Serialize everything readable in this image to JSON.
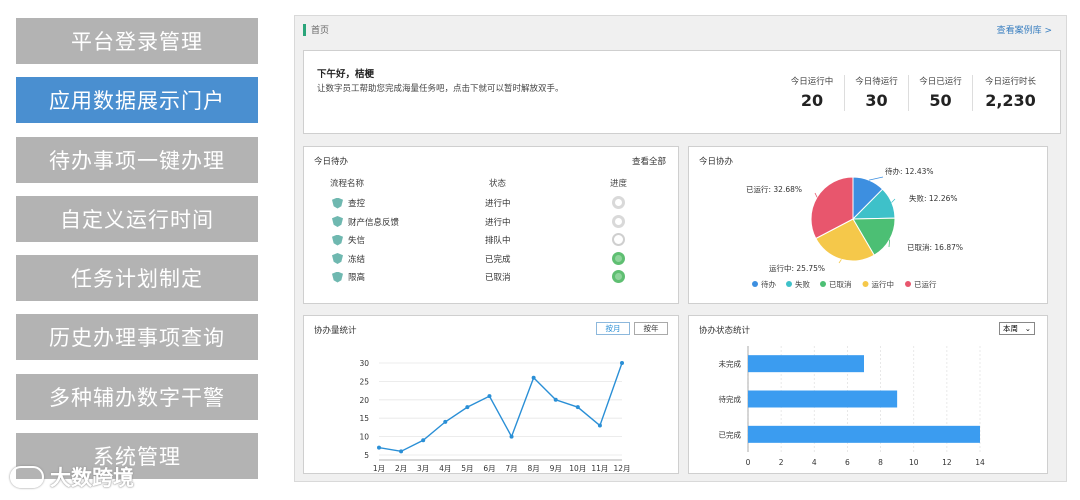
{
  "menu": {
    "items": [
      {
        "label": "平台登录管理",
        "active": false
      },
      {
        "label": "应用数据展示门户",
        "active": true
      },
      {
        "label": "待办事项一键办理",
        "active": false
      },
      {
        "label": "自定义运行时间",
        "active": false
      },
      {
        "label": "任务计划制定",
        "active": false
      },
      {
        "label": "历史办理事项查询",
        "active": false
      },
      {
        "label": "多种辅办数字干警",
        "active": false
      },
      {
        "label": "系统管理",
        "active": false
      }
    ]
  },
  "watermark": "大数跨境",
  "breadcrumb": "首页",
  "cases_link": "查看案例库 >",
  "welcome": {
    "greeting": "下午好，桔梗",
    "subtitle": "让数字员工帮助您完成海量任务吧，点击下就可以暂时解放双手。",
    "stats": [
      {
        "label": "今日运行中",
        "value": "20"
      },
      {
        "label": "今日待运行",
        "value": "30"
      },
      {
        "label": "今日已运行",
        "value": "50"
      },
      {
        "label": "今日运行时长",
        "value": "2,230"
      }
    ]
  },
  "todo": {
    "title": "今日待办",
    "view_all": "查看全部",
    "headers": {
      "name": "流程名称",
      "state": "状态",
      "progress": "进度"
    },
    "rows": [
      {
        "name": "查控",
        "state": "进行中",
        "progress": "running"
      },
      {
        "name": "财产信息反馈",
        "state": "进行中",
        "progress": "running"
      },
      {
        "name": "失信",
        "state": "排队中",
        "progress": "queued"
      },
      {
        "name": "冻结",
        "state": "已完成",
        "progress": "done"
      },
      {
        "name": "限高",
        "state": "已取消",
        "progress": "done"
      }
    ]
  },
  "collab": {
    "title": "今日协办",
    "colors": [
      "#3d8fe0",
      "#3ec1c9",
      "#4cbf74",
      "#f5c84a",
      "#e8566d"
    ],
    "slices": [
      {
        "name": "待办",
        "percent": 12.43,
        "label": "待办: 12.43%"
      },
      {
        "name": "失败",
        "percent": 12.26,
        "label": "失败: 12.26%"
      },
      {
        "name": "已取消",
        "percent": 16.87,
        "label": "已取消: 16.87%"
      },
      {
        "name": "运行中",
        "percent": 25.75,
        "label": "运行中: 25.75%"
      },
      {
        "name": "已运行",
        "percent": 32.68,
        "label": "已运行: 32.68%"
      }
    ]
  },
  "count": {
    "title": "协办量统计",
    "btn_month": "按月",
    "btn_year": "按年",
    "accent": "#2a8fd6"
  },
  "status": {
    "title": "协办状态统计",
    "select_value": "本周",
    "accent": "#3b9cf0"
  },
  "chart_data": [
    {
      "type": "line",
      "x": [
        "1月",
        "2月",
        "3月",
        "4月",
        "5月",
        "6月",
        "7月",
        "8月",
        "9月",
        "10月",
        "11月",
        "12月"
      ],
      "series": [
        {
          "values": [
            7,
            6,
            9,
            14,
            18,
            21,
            10,
            26,
            20,
            18,
            13,
            30
          ]
        }
      ],
      "ylim": [
        5,
        30
      ],
      "yticks": [
        "5",
        "10",
        "15",
        "20",
        "25",
        "30"
      ],
      "grid": true
    },
    {
      "type": "bar",
      "orientation": "horizontal",
      "categories": [
        "未完成",
        "待完成",
        "已完成"
      ],
      "values": [
        7,
        9,
        14
      ],
      "xlim": [
        0,
        14
      ],
      "xticks": [
        "0",
        "2",
        "4",
        "6",
        "8",
        "10",
        "12",
        "14"
      ],
      "grid": true
    },
    {
      "type": "pie",
      "categories": [
        "待办",
        "失败",
        "已取消",
        "运行中",
        "已运行"
      ],
      "values": [
        12.43,
        12.26,
        16.87,
        25.75,
        32.68
      ]
    }
  ]
}
